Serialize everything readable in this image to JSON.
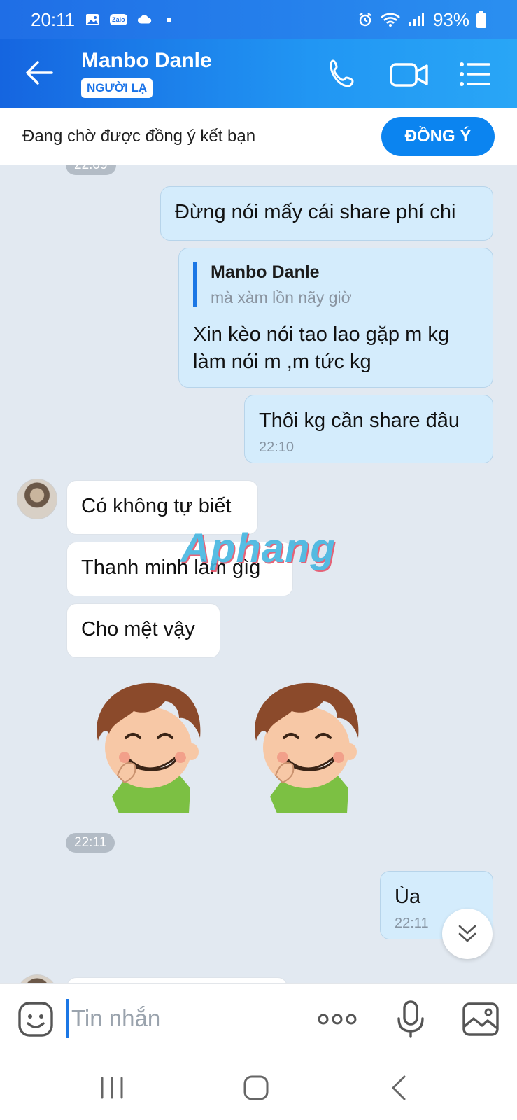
{
  "status_bar": {
    "time": "20:11",
    "battery": "93%",
    "zalo_label": "Zalo"
  },
  "header": {
    "contact_name": "Manbo Danle",
    "badge": "NGƯỜI LẠ"
  },
  "friend_request": {
    "text": "Đang chờ được đồng ý kết bạn",
    "accept_label": "ĐỒNG Ý"
  },
  "chat": {
    "partial_time_chip": "22:09",
    "messages": [
      {
        "text": "Đừng nói mấy cái share phí chi"
      },
      {
        "quote_name": "Manbo Danle",
        "quote_text": "mà xàm lồn nãy giờ",
        "text": "Xin kèo nói tao lao gặp m kg làm nói m ,m tức kg"
      },
      {
        "text": "Thôi kg cần share đâu",
        "time": "22:10"
      },
      {
        "text": "Có không tự biết"
      },
      {
        "text": "Thanh minh làm gìg"
      },
      {
        "text": "Cho mệt vậy"
      },
      {
        "text": "Ùa",
        "time": "22:11"
      }
    ],
    "sticker_time_chip": "22:11",
    "watermark": "Aphang"
  },
  "input": {
    "placeholder": "Tin nhắn"
  },
  "colors": {
    "accent": "#1b77e5",
    "header_start": "#1565e0",
    "header_end": "#29a6f6",
    "sent_bubble": "#d4ecfc",
    "chat_bg": "#e2e9f1"
  },
  "icons": [
    "back-arrow-icon",
    "phone-icon",
    "video-call-icon",
    "menu-icon",
    "emoji-icon",
    "more-icon",
    "microphone-icon",
    "image-icon",
    "chevron-down-icon"
  ]
}
